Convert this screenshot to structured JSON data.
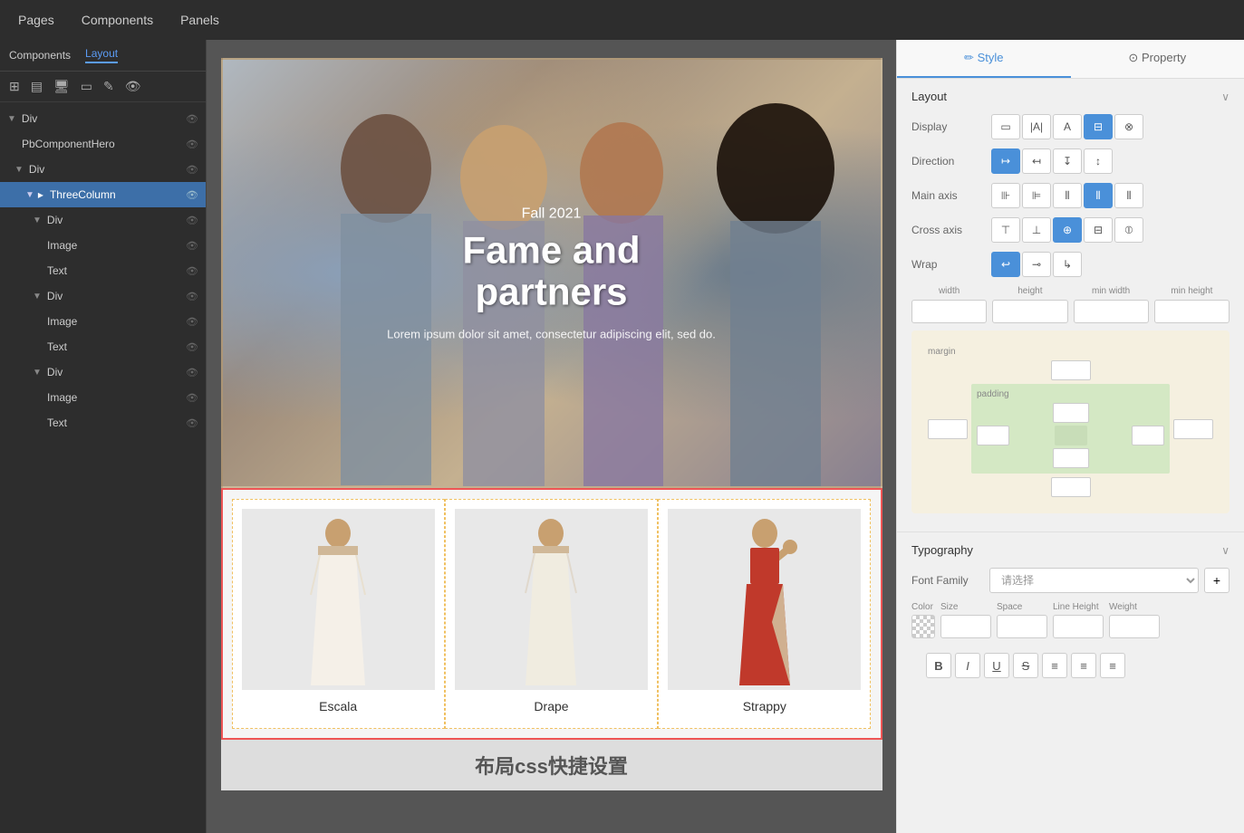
{
  "topnav": {
    "items": [
      "Pages",
      "Components",
      "Panels"
    ]
  },
  "sidebar": {
    "header_label": "Components",
    "layout_tab": "Layout",
    "toolbar_icons": [
      "grid-icon",
      "layout-icon",
      "desktop-icon",
      "tablet-icon",
      "edit-icon",
      "eye-icon"
    ],
    "tree": [
      {
        "id": "div1",
        "label": "Div",
        "level": 0,
        "expanded": true
      },
      {
        "id": "pbcomponent",
        "label": "PbComponentHero",
        "level": 1,
        "expanded": false
      },
      {
        "id": "div2",
        "label": "Div",
        "level": 1,
        "expanded": true
      },
      {
        "id": "threecolumn",
        "label": "ThreeColumn",
        "level": 2,
        "expanded": true,
        "selected": true
      },
      {
        "id": "div3",
        "label": "Div",
        "level": 3,
        "expanded": true
      },
      {
        "id": "image1",
        "label": "Image",
        "level": 4,
        "expanded": false
      },
      {
        "id": "text1",
        "label": "Text",
        "level": 4,
        "expanded": false
      },
      {
        "id": "div4",
        "label": "Div",
        "level": 3,
        "expanded": true
      },
      {
        "id": "image2",
        "label": "Image",
        "level": 4,
        "expanded": false
      },
      {
        "id": "text2",
        "label": "Text",
        "level": 4,
        "expanded": false
      },
      {
        "id": "div5",
        "label": "Div",
        "level": 3,
        "expanded": true
      },
      {
        "id": "image3",
        "label": "Image",
        "level": 4,
        "expanded": false
      },
      {
        "id": "text3",
        "label": "Text",
        "level": 4,
        "expanded": false
      }
    ]
  },
  "canvas": {
    "hero": {
      "subtitle": "Fall 2021",
      "title": "Fame and partners",
      "description": "Lorem ipsum dolor sit amet, consectetur adipiscing elit, sed do."
    },
    "products": [
      {
        "name": "Escala",
        "type": "white"
      },
      {
        "name": "Drape",
        "type": "white"
      },
      {
        "name": "Strappy",
        "type": "red"
      }
    ],
    "bottom_text": "布局css快捷设置"
  },
  "right_panel": {
    "tabs": [
      "Style",
      "Property"
    ],
    "active_tab": "Style",
    "layout_section": {
      "title": "Layout",
      "display": {
        "label": "Display",
        "buttons": [
          "box-icon",
          "text-inline-icon",
          "text-block-icon",
          "grid-icon",
          "hidden-icon"
        ],
        "active": 3
      },
      "direction": {
        "label": "Direction",
        "buttons": [
          "row-icon",
          "row-reverse-icon",
          "col-icon",
          "col-reverse-icon"
        ],
        "active": 0
      },
      "main_axis": {
        "label": "Main axis",
        "buttons": [
          "start-icon",
          "end-icon",
          "center-icon",
          "space-between-icon",
          "space-around-icon"
        ],
        "active": 3
      },
      "cross_axis": {
        "label": "Cross axis",
        "buttons": [
          "start-icon",
          "end-icon",
          "center-icon",
          "baseline-icon",
          "stretch-icon"
        ],
        "active": 2
      },
      "wrap": {
        "label": "Wrap",
        "buttons": [
          "wrap-icon",
          "nowrap-icon",
          "wrap-reverse-icon"
        ],
        "active": 0
      },
      "dimensions": {
        "width": {
          "label": "width",
          "value": ""
        },
        "height": {
          "label": "height",
          "value": ""
        },
        "min_width": {
          "label": "min width",
          "value": ""
        },
        "min_height": {
          "label": "min height",
          "value": ""
        }
      },
      "margin": {
        "label": "margin",
        "top": "",
        "right": "",
        "bottom": "",
        "left": "",
        "center": ""
      },
      "padding": {
        "label": "padding",
        "top": "",
        "right": "",
        "bottom": "",
        "left": "",
        "center": ""
      }
    },
    "typography_section": {
      "title": "Typography",
      "font_family_placeholder": "请选择",
      "font_add_label": "+",
      "color_label": "Color",
      "size_label": "Size",
      "space_label": "Space",
      "line_height_label": "Line Height",
      "weight_label": "Weight",
      "format_buttons": [
        "B",
        "I",
        "U",
        "S",
        "align-left",
        "align-center",
        "align-right"
      ]
    }
  }
}
